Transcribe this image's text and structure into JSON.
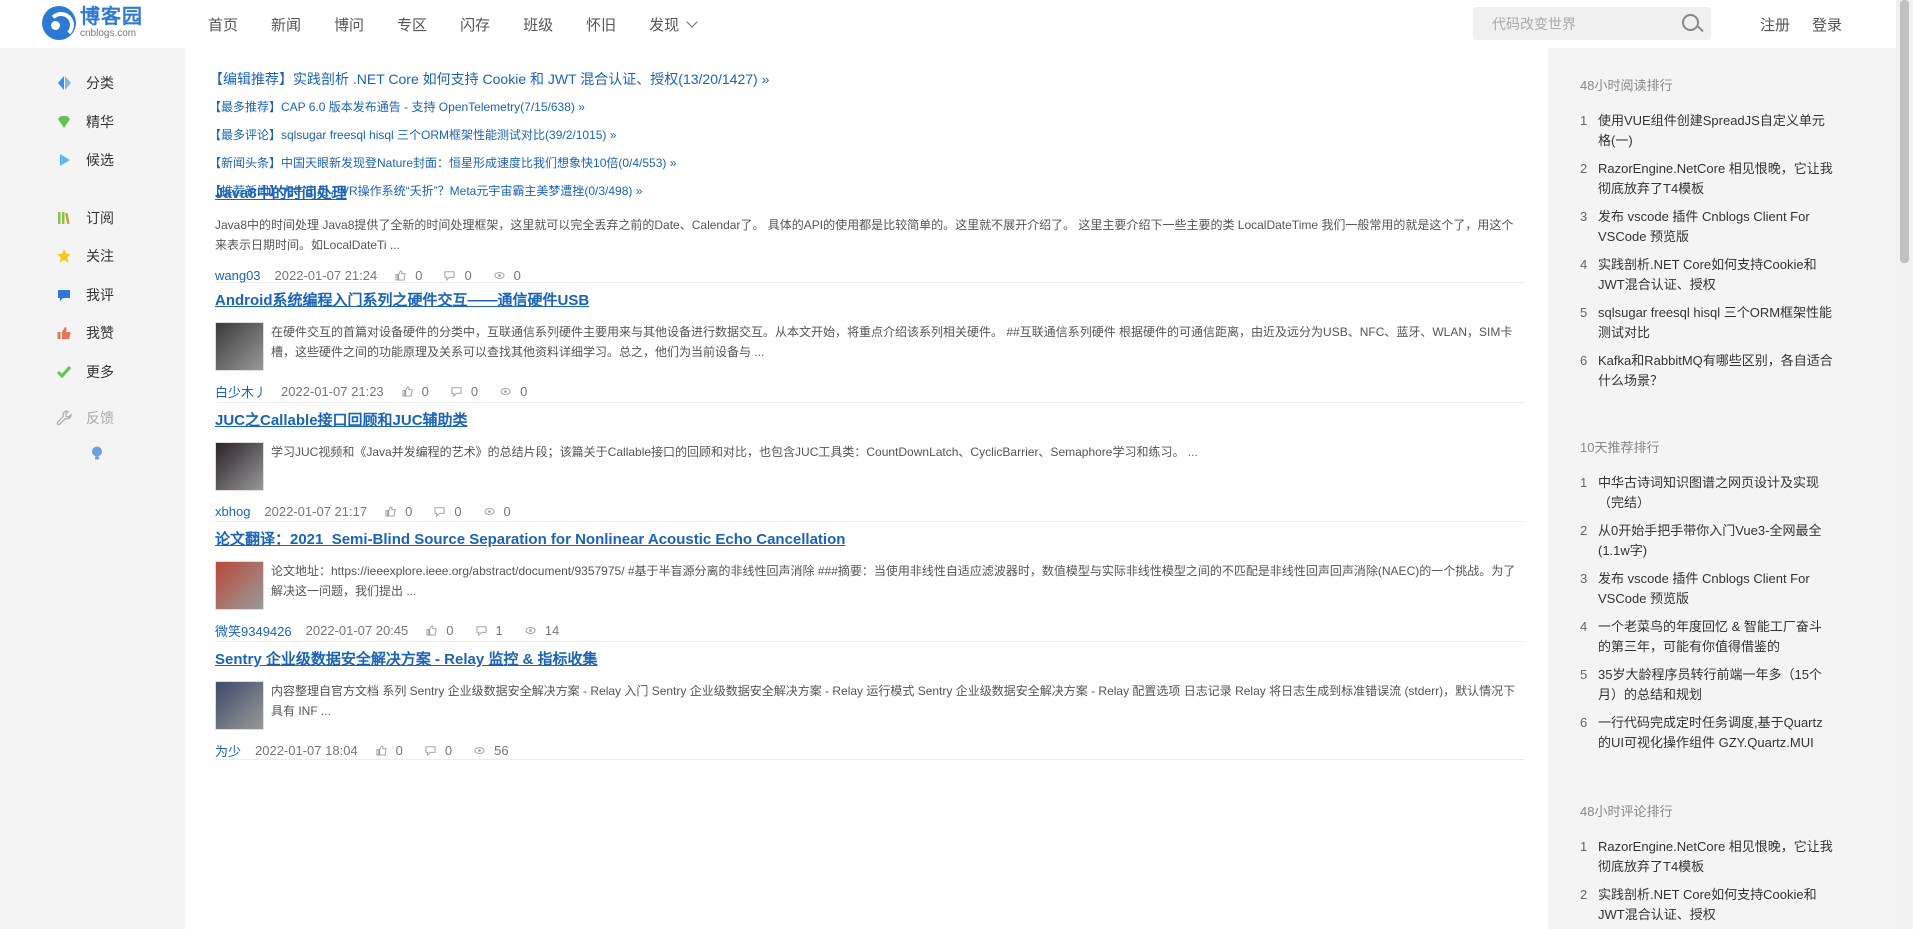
{
  "logo": {
    "name": "博客园",
    "domain": "cnblogs.com"
  },
  "nav": {
    "items": [
      "首页",
      "新闻",
      "博问",
      "专区",
      "闪存",
      "班级",
      "怀旧",
      "发现"
    ]
  },
  "search": {
    "placeholder": "代码改变世界"
  },
  "auth": {
    "register": "注册",
    "login": "登录"
  },
  "sidebar": {
    "group1": [
      {
        "label": "分类",
        "icon": "diamond-split-icon",
        "color": "#3a8ee6"
      },
      {
        "label": "精华",
        "icon": "gem-icon",
        "color": "#5cc54c"
      },
      {
        "label": "候选",
        "icon": "play-triangle-icon",
        "color": "#5cb8f0"
      }
    ],
    "group2": [
      {
        "label": "订阅",
        "icon": "books-icon",
        "color": "#8bc34a"
      },
      {
        "label": "关注",
        "icon": "star-icon",
        "color": "#f5c518"
      },
      {
        "label": "我评",
        "icon": "comment-bubble-icon",
        "color": "#2d79d6"
      },
      {
        "label": "我赞",
        "icon": "thumbs-up-icon",
        "color": "#e8735a"
      },
      {
        "label": "更多",
        "icon": "check-icon",
        "color": "#5cc54c"
      }
    ],
    "feedback": {
      "label": "反馈",
      "icon": "wrench-icon"
    },
    "bulb": {
      "icon": "lightbulb-icon"
    }
  },
  "recommend": [
    "【编辑推荐】实践剖析 .NET Core 如何支持 Cookie 和 JWT 混合认证、授权(13/20/1427) »",
    "【最多推荐】CAP 6.0 版本发布通告 - 支持 OpenTelemetry(7/15/638) »",
    "【最多评论】sqlsugar freesql hisql 三个ORM框架性能测试对比(39/2/1015) »",
    "【新闻头条】中国天眼新发现登Nature封面：恒星形成速度比我们想象快10倍(0/4/553) »",
    "【推荐新闻】大牛出走，VR操作系统“夭折”？Meta元宇宙霸主美梦遭挫(0/3/498) »"
  ],
  "posts": [
    {
      "title": "Java8中的时间处理",
      "summary": "Java8中的时间处理 Java8提供了全新的时间处理框架，这里就可以完全丢弃之前的Date、Calendar了。 具体的API的使用都是比较简单的。这里就不展开介绍了。 这里主要介绍下一些主要的类 LocalDateTime 我们一般常用的就是这个了，用这个来表示日期时间。如LocalDateTi ...",
      "author": "wang03",
      "time": "2022-01-07 21:24",
      "likes": "0",
      "comments": "0",
      "views": "0",
      "has_thumb": false
    },
    {
      "title": "Android系统编程入门系列之硬件交互——通信硬件USB",
      "summary": "在硬件交互的首篇对设备硬件的分类中，互联通信系列硬件主要用来与其他设备进行数据交互。从本文开始，将重点介绍该系列相关硬件。 ##互联通信系列硬件 根据硬件的可通信距离，由近及远分为USB、NFC、蓝牙、WLAN，SIM卡槽，这些硬件之间的功能原理及关系可以查找其他资料详细学习。总之，他们为当前设备与 ...",
      "author": "白少木丿",
      "time": "2022-01-07 21:23",
      "likes": "0",
      "comments": "0",
      "views": "0",
      "has_thumb": true,
      "thumb_color": "#3a3a3a"
    },
    {
      "title": "JUC之Callable接口回顾和JUC辅助类",
      "summary": "学习JUC视频和《Java并发编程的艺术》的总结片段；该篇关于Callable接口的回顾和对比，也包含JUC工具类：CountDownLatch、CyclicBarrier、Semaphore学习和练习。 ...",
      "author": "xbhog",
      "time": "2022-01-07 21:17",
      "likes": "0",
      "comments": "0",
      "views": "0",
      "has_thumb": true,
      "thumb_color": "#2a2228"
    },
    {
      "title": "论文翻译：2021_Semi-Blind Source Separation for Nonlinear Acoustic Echo Cancellation",
      "summary": "论文地址：https://ieeexplore.ieee.org/abstract/document/9357975/ #基于半盲源分离的非线性回声消除 ###摘要：当使用非线性自适应滤波器时，数值模型与实际非线性模型之间的不匹配是非线性回声回声消除(NAEC)的一个挑战。为了解决这一问题，我们提出 ...",
      "author": "微笑9349426",
      "time": "2022-01-07 20:45",
      "likes": "0",
      "comments": "1",
      "views": "14",
      "has_thumb": true,
      "thumb_color": "#b84a3a"
    },
    {
      "title": "Sentry 企业级数据安全解决方案 - Relay 监控 & 指标收集",
      "summary": "内容整理自官方文档 系列 Sentry 企业级数据安全解决方案 - Relay 入门 Sentry 企业级数据安全解决方案 - Relay 运行模式 Sentry 企业级数据安全解决方案 - Relay 配置选项 日志记录 Relay 将日志生成到标准错误流 (stderr)，默认情况下具有 INF ...",
      "author": "为少",
      "time": "2022-01-07 18:04",
      "likes": "0",
      "comments": "0",
      "views": "56",
      "has_thumb": true,
      "thumb_color": "#3d4a6a"
    }
  ],
  "rankings": [
    {
      "title": "48小时阅读排行",
      "items": [
        "使用VUE组件创建SpreadJS自定义单元格(一)",
        "RazorEngine.NetCore 相见恨晚，它让我彻底放弃了T4模板",
        "发布 vscode 插件 Cnblogs Client For VSCode 预览版",
        "实践剖析.NET Core如何支持Cookie和JWT混合认证、授权",
        "sqlsugar freesql hisql 三个ORM框架性能测试对比",
        "Kafka和RabbitMQ有哪些区别，各自适合什么场景？"
      ]
    },
    {
      "title": "10天推荐排行",
      "items": [
        "中华古诗词知识图谱之网页设计及实现（完结）",
        "从0开始手把手带你入门Vue3-全网最全(1.1w字)",
        "发布 vscode 插件 Cnblogs Client For VSCode 预览版",
        "一个老菜鸟的年度回忆 & 智能工厂奋斗的第三年，可能有你值得借鉴的",
        "35岁大龄程序员转行前端一年多（15个月）的总结和规划",
        "一行代码完成定时任务调度,基于Quartz的UI可视化操作组件 GZY.Quartz.MUI"
      ]
    },
    {
      "title": "48小时评论排行",
      "items": [
        "RazorEngine.NetCore 相见恨晚，它让我彻底放弃了T4模板",
        "实践剖析.NET Core如何支持Cookie和JWT混合认证、授权"
      ]
    }
  ]
}
